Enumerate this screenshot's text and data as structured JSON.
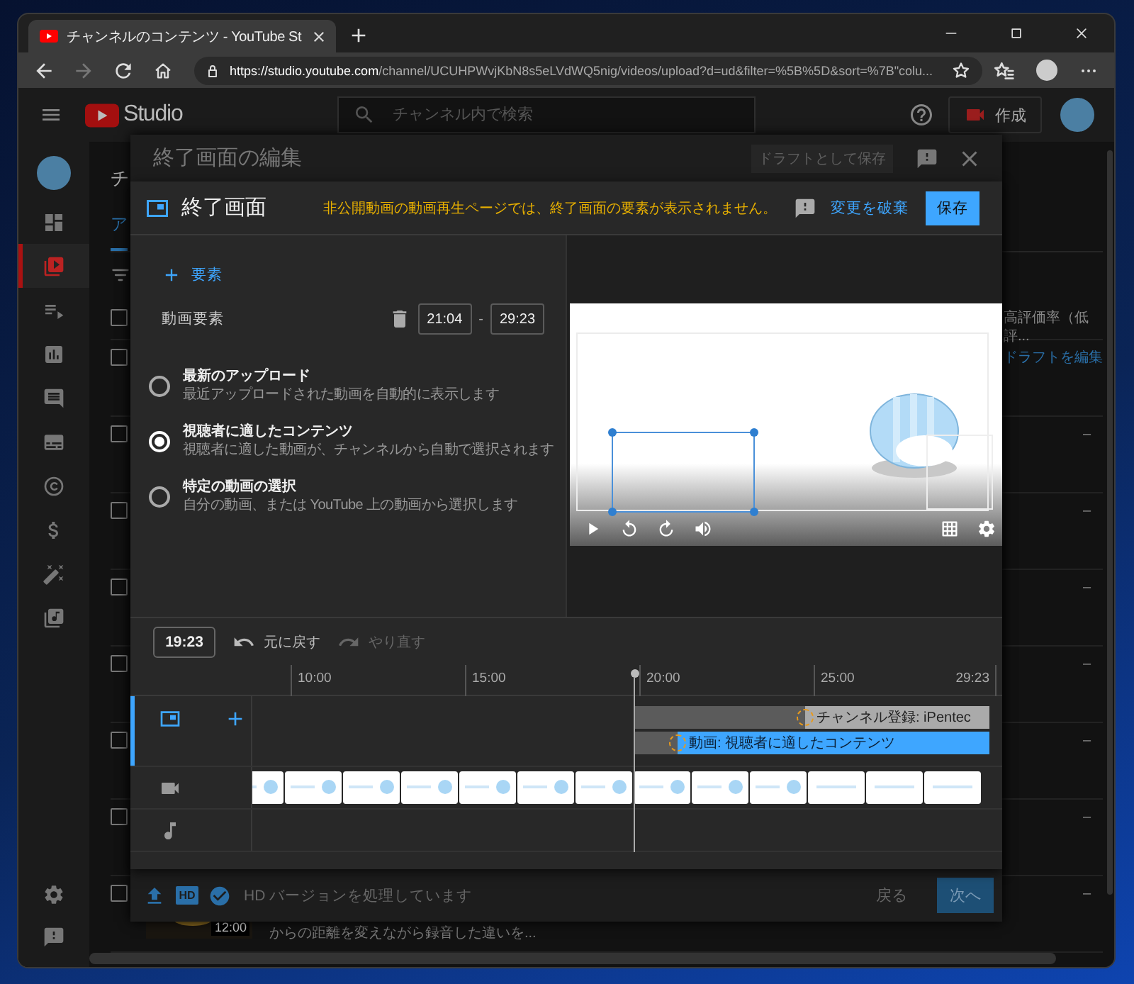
{
  "browser": {
    "tab_title": "チャンネルのコンテンツ - YouTube St",
    "url_host": "https://studio.youtube.com",
    "url_path": "/channel/UCUHPWvjKbN8s5eLVdWQ5nig/videos/upload?d=ud&filter=%5B%5D&sort=%7B\"colu...",
    "forward_disabled": true
  },
  "studio_header": {
    "logo_text": "Studio",
    "search_placeholder": "チャンネル内で検索",
    "create_button": "作成"
  },
  "sidebar": [
    {
      "kind": "dashboard",
      "selected": false
    },
    {
      "kind": "content",
      "selected": true
    },
    {
      "kind": "playlists",
      "selected": false
    },
    {
      "kind": "analytics",
      "selected": false
    },
    {
      "kind": "comments",
      "selected": false
    },
    {
      "kind": "subtitles",
      "selected": false
    },
    {
      "kind": "copyright",
      "selected": false
    },
    {
      "kind": "earn",
      "selected": false
    },
    {
      "kind": "customization",
      "selected": false
    },
    {
      "kind": "audio_library",
      "selected": false
    }
  ],
  "sidebar_bottom": [
    {
      "kind": "settings"
    },
    {
      "kind": "feedback"
    }
  ],
  "content_page": {
    "title_fragment": "チ",
    "tab": {
      "label": "ア",
      "selected": true
    },
    "header_checked": false,
    "column_header": "高評価率（低評...",
    "rows": [
      {
        "kind": "link",
        "text": "ドラフトを編集",
        "checked": false
      },
      {
        "kind": "value",
        "text": "–",
        "checked": false
      },
      {
        "kind": "value",
        "text": "–",
        "checked": false
      },
      {
        "kind": "value",
        "text": "–",
        "checked": false
      },
      {
        "kind": "value",
        "text": "–",
        "checked": false
      },
      {
        "kind": "value",
        "text": "–",
        "checked": false
      },
      {
        "kind": "value",
        "text": "–",
        "checked": false
      },
      {
        "kind": "value",
        "text": "–",
        "checked": false,
        "duration": "12:00",
        "description": "からの距離を変えながら録音した違いを..."
      }
    ]
  },
  "upload_dialog": {
    "title": "終了画面の編集",
    "save_draft_button": "ドラフトとして保存",
    "hd_badge": "HD",
    "status": "HD バージョンを処理しています",
    "back_button": "戻る",
    "next_button": "次へ"
  },
  "end_screen": {
    "title": "終了画面",
    "warning": "非公開動画の動画再生ページでは、終了画面の要素が表示されません。",
    "discard_button": "変更を破棄",
    "save_button": "保存",
    "add_element_button": "要素",
    "element": {
      "label": "動画要素",
      "start_time": "21:04",
      "range_separator": "-",
      "end_time": "29:23"
    },
    "options": [
      {
        "title": "最新のアップロード",
        "description": "最近アップロードされた動画を自動的に表示します",
        "selected": false
      },
      {
        "title": "視聴者に適したコンテンツ",
        "description": "視聴者に適した動画が、チャンネルから自動で選択されます",
        "selected": true
      },
      {
        "title": "特定の動画の選択",
        "description": "自分の動画、または YouTube 上の動画から選択します",
        "selected": false
      }
    ],
    "timeline": {
      "current_time": "19:23",
      "undo": {
        "label": "元に戻す",
        "disabled": false
      },
      "redo": {
        "label": "やり直す",
        "disabled": true
      },
      "ticks": [
        "10:00",
        "15:00",
        "20:00",
        "25:00",
        "29:23"
      ],
      "tracks": [
        {
          "kind": "end_screen",
          "selected": true,
          "elements": [
            {
              "label": "チャンネル登録: iPentec",
              "selected": false
            },
            {
              "label": "動画: 視聴者に適したコンテンツ",
              "selected": true
            }
          ]
        },
        {
          "kind": "video",
          "selected": false
        },
        {
          "kind": "audio",
          "selected": false
        }
      ]
    }
  }
}
